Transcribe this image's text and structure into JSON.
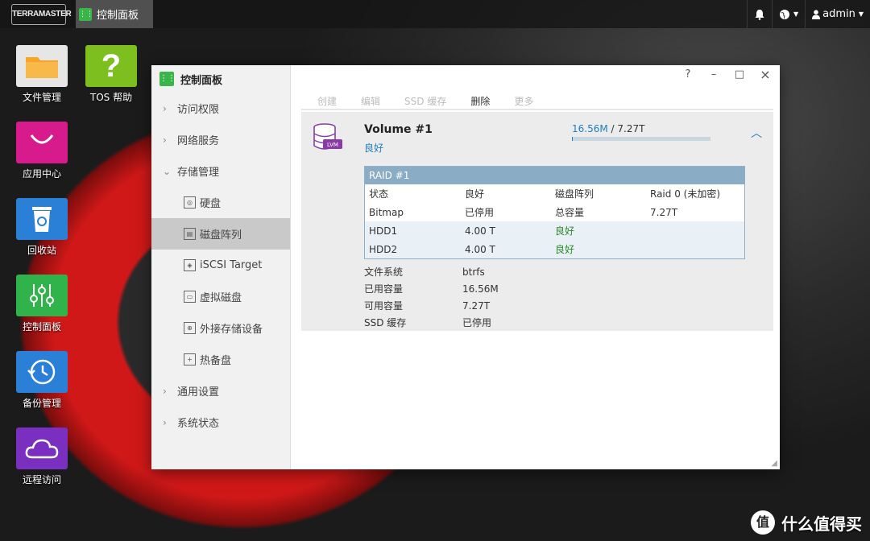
{
  "taskbar": {
    "logo": "TERRAMASTER",
    "active_task": "控制面板",
    "right": {
      "notify_icon": "bell-icon",
      "help_icon": "globe-icon",
      "user": "admin"
    }
  },
  "desktop": {
    "icons": [
      {
        "label": "文件管理",
        "color": "#f0a030",
        "icon": "folder-icon"
      },
      {
        "label": "TOS 帮助",
        "color": "#7cbf1e",
        "icon": "question-icon"
      },
      {
        "label": "应用中心",
        "color": "#d81b8c",
        "icon": "shopping-bag-icon"
      },
      {
        "label": "回收站",
        "color": "#2a7fd6",
        "icon": "recycle-bin-icon"
      },
      {
        "label": "控制面板",
        "color": "#2fb34a",
        "icon": "sliders-icon"
      },
      {
        "label": "备份管理",
        "color": "#2a7fd6",
        "icon": "clock-icon"
      },
      {
        "label": "远程访问",
        "color": "#7a2fc0",
        "icon": "cloud-icon"
      }
    ]
  },
  "window": {
    "title": "控制面板",
    "controls": {
      "help": "?",
      "minimize": "–",
      "maximize": "□",
      "close": "×"
    },
    "sidebar": {
      "items": [
        {
          "label": "访问权限"
        },
        {
          "label": "网络服务"
        },
        {
          "label": "存储管理"
        },
        {
          "label": "通用设置"
        },
        {
          "label": "系统状态"
        }
      ],
      "storage_sub": [
        {
          "label": "硬盘",
          "icon": "disk-icon"
        },
        {
          "label": "磁盘阵列",
          "icon": "raid-icon"
        },
        {
          "label": "iSCSI Target",
          "icon": "iscsi-icon"
        },
        {
          "label": "虚拟磁盘",
          "icon": "virtual-disk-icon"
        },
        {
          "label": "外接存储设备",
          "icon": "external-storage-icon"
        },
        {
          "label": "热备盘",
          "icon": "hot-spare-icon"
        }
      ]
    },
    "toolbar": {
      "create": "创建",
      "edit": "编辑",
      "ssd_cache": "SSD 缓存",
      "delete": "删除",
      "more": "更多"
    },
    "volume": {
      "badge": "LVM",
      "name": "Volume #1",
      "status": "良好",
      "used": "16.56M",
      "separator": " / ",
      "total": "7.27T",
      "usage_fraction": 0.0022
    },
    "raid": {
      "title": "RAID #1",
      "rows": [
        [
          "状态",
          "良好",
          "磁盘阵列",
          "Raid 0 (未加密)"
        ],
        [
          "Bitmap",
          "已停用",
          "总容量",
          "7.27T"
        ]
      ],
      "disks": [
        [
          "HDD1",
          "4.00 T",
          "良好"
        ],
        [
          "HDD2",
          "4.00 T",
          "良好"
        ]
      ]
    },
    "info": [
      [
        "文件系统",
        "btrfs"
      ],
      [
        "已用容量",
        "16.56M"
      ],
      [
        "可用容量",
        "7.27T"
      ],
      [
        "SSD 缓存",
        "已停用"
      ]
    ]
  },
  "watermark": {
    "badge": "值",
    "text": "什么值得买"
  }
}
